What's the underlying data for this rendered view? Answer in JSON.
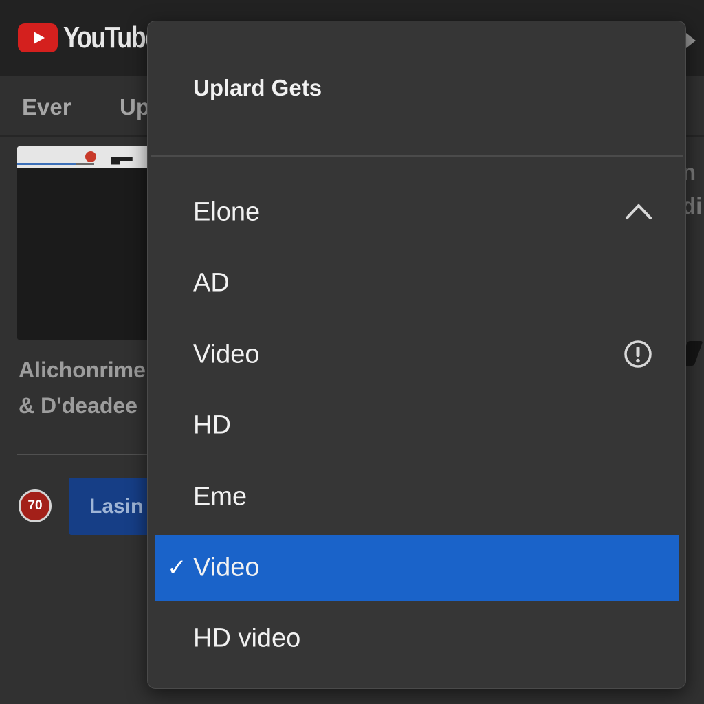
{
  "header": {
    "brand": "YouTube"
  },
  "subnav": {
    "tabs": [
      {
        "label": "Ever"
      },
      {
        "label": "Up"
      }
    ]
  },
  "background": {
    "video_title_line1": "Alichonrime",
    "video_title_line2": "& D'deadee",
    "channel_avatar": "70",
    "action_button": "Lasin",
    "peek_line1": "n",
    "peek_line2": "di"
  },
  "dropdown": {
    "header": "Uplard Gets",
    "items": [
      {
        "label": "Elone",
        "icon": "chevron-up-icon",
        "selected": false
      },
      {
        "label": "AD",
        "selected": false
      },
      {
        "label": "Video",
        "icon": "alert-icon",
        "selected": false
      },
      {
        "label": "HD",
        "selected": false
      },
      {
        "label": "Eme",
        "selected": false
      },
      {
        "label": "Video",
        "check": "✓",
        "selected": true
      },
      {
        "label": "HD video",
        "selected": false
      }
    ]
  },
  "colors": {
    "selected": "#1a63c9",
    "menu_bg": "#363636",
    "brand_red": "#d4201e"
  }
}
